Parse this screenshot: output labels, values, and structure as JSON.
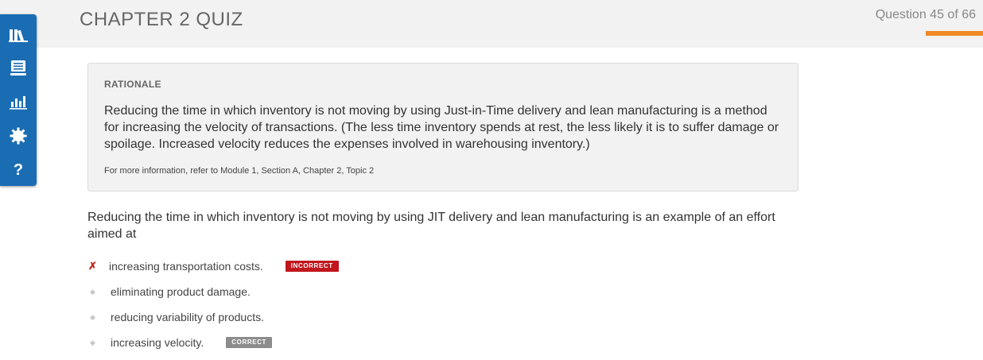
{
  "header": {
    "title": "CHAPTER 2 QUIZ",
    "progress_text": "Question 45 of 66",
    "progress": {
      "current": 45,
      "total": 66
    },
    "accent_color": "#f08a24"
  },
  "sidebar": {
    "color": "#1b6db3",
    "items": [
      {
        "icon": "library-icon"
      },
      {
        "icon": "flashcards-icon"
      },
      {
        "icon": "bar-chart-icon"
      },
      {
        "icon": "settings-gear-icon"
      },
      {
        "icon": "help-question-icon",
        "label": "?"
      }
    ]
  },
  "rationale": {
    "heading": "RATIONALE",
    "body": "Reducing the time in which inventory is not moving by using Just-in-Time delivery and lean manufacturing is a method for increasing the velocity of transactions. (The less time inventory spends at rest, the less likely it is to suffer damage or spoilage. Increased velocity reduces the expenses involved in warehousing inventory.)",
    "reference": "For more information, refer to Module 1, Section A, Chapter 2, Topic 2"
  },
  "question": {
    "text": "Reducing the time in which inventory is not moving by using JIT delivery and lean manufacturing is an example of an effort aimed at"
  },
  "answers": [
    {
      "marker": "✗",
      "text": "increasing transportation costs.",
      "badge": "INCORRECT"
    },
    {
      "marker": "◆",
      "text": "eliminating product damage.",
      "badge": ""
    },
    {
      "marker": "◆",
      "text": "reducing variability of products.",
      "badge": ""
    },
    {
      "marker": "◆",
      "text": "increasing velocity.",
      "badge": "CORRECT"
    }
  ],
  "colors": {
    "incorrect": "#c1161c",
    "correct_badge": "#8c8c8c"
  }
}
